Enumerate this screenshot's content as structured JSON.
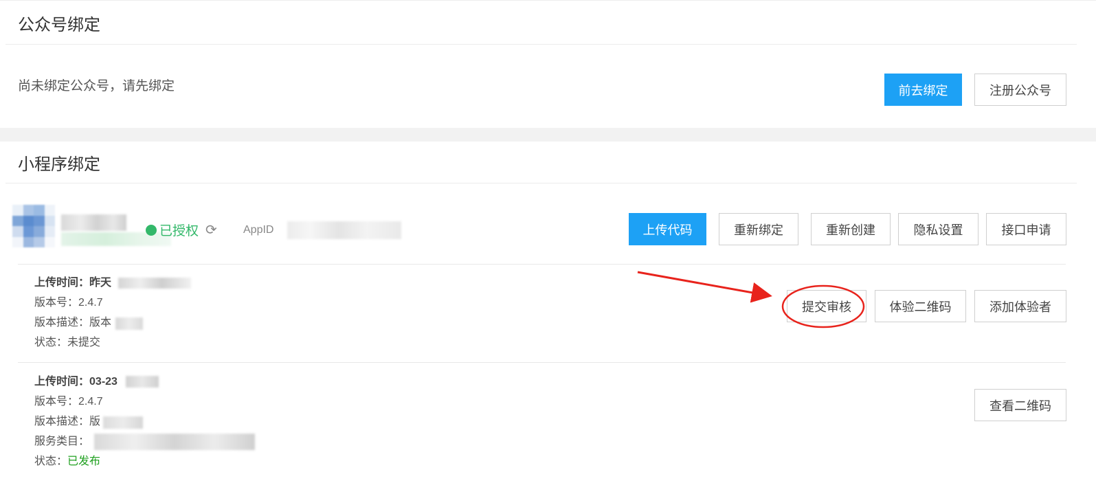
{
  "official_account": {
    "title": "公众号绑定",
    "hint": "尚未绑定公众号，请先绑定",
    "bind_button": "前去绑定",
    "register_button": "注册公众号"
  },
  "mini_program": {
    "title": "小程序绑定",
    "auth_status": "已授权",
    "appid_label": "AppID",
    "buttons": {
      "upload": "上传代码",
      "rebind": "重新绑定",
      "recreate": "重新创建",
      "privacy": "隐私设置",
      "api_apply": "接口申请"
    },
    "versions": [
      {
        "upload_time_label": "上传时间：",
        "upload_time_value": "昨天",
        "version_label": "版本号：",
        "version_value": "2.4.7",
        "desc_label": "版本描述：",
        "desc_value": "版本",
        "status_label": "状态：",
        "status_value": "未提交",
        "submit_button": "提交审核",
        "qrcode_button": "体验二维码",
        "add_tester_button": "添加体验者"
      },
      {
        "upload_time_label": "上传时间：",
        "upload_time_value": "03-23",
        "version_label": "版本号：",
        "version_value": "2.4.7",
        "desc_label": "版本描述：",
        "desc_value": "版",
        "category_label": "服务类目：",
        "status_label": "状态：",
        "status_value": "已发布",
        "view_qrcode_button": "查看二维码"
      }
    ]
  },
  "colors": {
    "primary": "#1da1f5",
    "success": "#33b86a",
    "published": "#20a020",
    "annotation": "#e8231c"
  },
  "icons": {
    "auth": "check-circle-icon",
    "refresh": "refresh-icon"
  }
}
